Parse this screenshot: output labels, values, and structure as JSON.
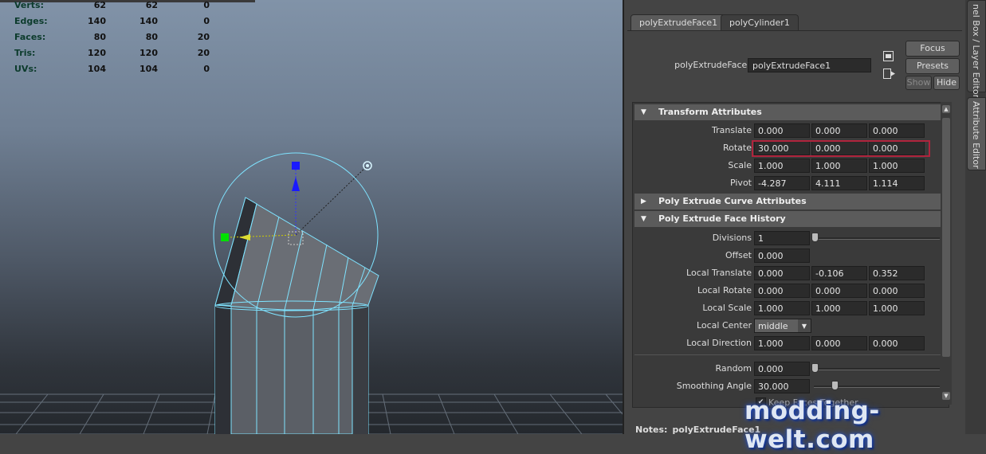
{
  "hud": {
    "rows": [
      {
        "label": "Verts:",
        "v1": "62",
        "v2": "62",
        "v3": "0"
      },
      {
        "label": "Edges:",
        "v1": "140",
        "v2": "140",
        "v3": "0"
      },
      {
        "label": "Faces:",
        "v1": "80",
        "v2": "80",
        "v3": "20"
      },
      {
        "label": "Tris:",
        "v1": "120",
        "v2": "120",
        "v3": "20"
      },
      {
        "label": "UVs:",
        "v1": "104",
        "v2": "104",
        "v3": "0"
      }
    ]
  },
  "tabs": [
    "polyExtrudeFace1",
    "polyCylinder1"
  ],
  "node": {
    "label": "polyExtrudeFace:",
    "value": "polyExtrudeFace1"
  },
  "buttons": {
    "focus": "Focus",
    "presets": "Presets",
    "show": "Show",
    "hide": "Hide"
  },
  "sections": {
    "transform": {
      "title": "Transform Attributes",
      "rows": [
        {
          "label": "Translate",
          "values": [
            "0.000",
            "0.000",
            "0.000"
          ]
        },
        {
          "label": "Rotate",
          "values": [
            "30.000",
            "0.000",
            "0.000"
          ]
        },
        {
          "label": "Scale",
          "values": [
            "1.000",
            "1.000",
            "1.000"
          ]
        },
        {
          "label": "Pivot",
          "values": [
            "-4.287",
            "4.111",
            "1.114"
          ]
        }
      ]
    },
    "curve": {
      "title": "Poly Extrude Curve Attributes"
    },
    "history": {
      "title": "Poly Extrude Face History",
      "divisions": {
        "label": "Divisions",
        "value": "1"
      },
      "offset": {
        "label": "Offset",
        "value": "0.000"
      },
      "local_translate": {
        "label": "Local Translate",
        "values": [
          "0.000",
          "-0.106",
          "0.352"
        ]
      },
      "local_rotate": {
        "label": "Local Rotate",
        "values": [
          "0.000",
          "0.000",
          "0.000"
        ]
      },
      "local_scale": {
        "label": "Local Scale",
        "values": [
          "1.000",
          "1.000",
          "1.000"
        ]
      },
      "local_center": {
        "label": "Local Center",
        "value": "middle"
      },
      "local_direction": {
        "label": "Local Direction",
        "values": [
          "1.000",
          "0.000",
          "0.000"
        ]
      },
      "random": {
        "label": "Random",
        "value": "0.000"
      },
      "smoothing": {
        "label": "Smoothing Angle",
        "value": "30.000"
      },
      "keep_faces": {
        "label": "Keep Faces Together"
      }
    }
  },
  "notes": {
    "label": "Notes:",
    "value": "polyExtrudeFace1"
  },
  "side_tabs": {
    "channel": "nel Box / Layer Editor",
    "attribute": "Attribute Editor"
  },
  "watermark": "modding-welt.com",
  "colors": {
    "accent_highlight": "#b0243d",
    "manip_blue": "#1a1aff",
    "manip_green": "#00e000",
    "wire": "#7fe3ff"
  }
}
